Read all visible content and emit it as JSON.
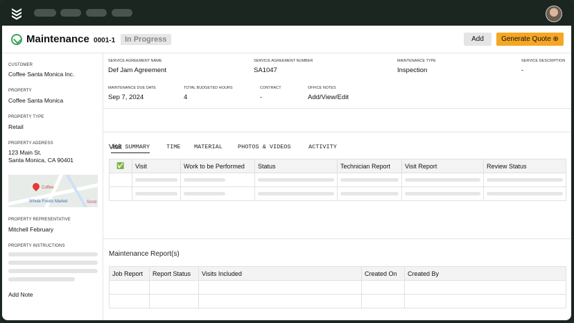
{
  "header": {
    "title": "Maintenance",
    "number": "0001-1",
    "status": "In Progress",
    "add_label": "Add",
    "quote_label": "Generate Quote ⊕"
  },
  "sidebar": {
    "customer_label": "CUSTOMER",
    "customer": "Coffee Santa Monica Inc.",
    "property_label": "PROPERTY",
    "property": "Coffee Santa Monica",
    "property_type_label": "PROPERTY TYPE",
    "property_type": "Retail",
    "address_label": "PROPERTY ADDRESS",
    "address_line1": "123 Main St.",
    "address_line2": "Santa Monica, CA 90401",
    "map_labels": [
      "Coffee",
      "Whole Foods Market",
      "Sond"
    ],
    "rep_label": "PROPERTY REPRESENTATIVE",
    "rep": "Mitchell February",
    "instructions_label": "PROPERTY INSTRUCTIONS",
    "add_note": "Add Note"
  },
  "fields": {
    "agreement_name_label": "SERVICE AGREEMENT NAME",
    "agreement_name": "Def Jam Agreement",
    "agreement_number_label": "SERVICE AGREEMENT NUMBER",
    "agreement_number": "SA1047",
    "maintenance_type_label": "MAINTENANCE TYPE",
    "maintenance_type": "Inspection",
    "service_desc_label": "SERVICE DESCRIPTION",
    "service_desc": "-",
    "due_date_label": "MAINTENANCE DUE DATE",
    "due_date": "Sep 7, 2024",
    "hours_label": "TOTAL BUDGETED HOURS",
    "hours": "4",
    "contract_label": "CONTRACT",
    "contract": "-",
    "notes_label": "OFFICE NOTES",
    "notes": "Add/View/Edit"
  },
  "tabs": [
    "JOB SUMMARY",
    "TIME",
    "MATERIAL",
    "PHOTOS & VIDEOS",
    "ACTIVITY"
  ],
  "visit": {
    "title": "Visit",
    "columns": [
      "✅",
      "Visit",
      "Work to be Performed",
      "Status",
      "Technician Report",
      "Visit Report",
      "Review Status"
    ]
  },
  "reports": {
    "title": "Maintenance Report(s)",
    "columns": [
      "Job Report",
      "Report Status",
      "Visits Included",
      "Created  On",
      "Created By"
    ]
  }
}
